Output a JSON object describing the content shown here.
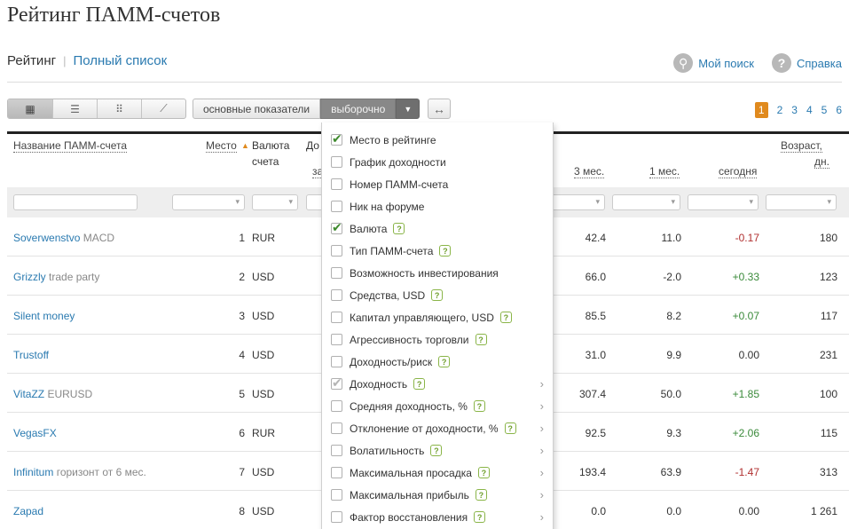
{
  "page": {
    "title": "Рейтинг ПАММ-счетов"
  },
  "tabs": [
    {
      "label": "Рейтинг",
      "active": true
    },
    {
      "label": "Полный список",
      "active": false
    }
  ],
  "top_links": {
    "my_search": "Мой поиск",
    "help": "Справка"
  },
  "view_buttons": [
    {
      "icon": "grid-icon",
      "glyph": "▦"
    },
    {
      "icon": "list-icon",
      "glyph": "☰"
    },
    {
      "icon": "tiles-icon",
      "glyph": "⠿"
    },
    {
      "icon": "chart-icon",
      "glyph": "⟋"
    }
  ],
  "modes": {
    "basic": "основные показатели",
    "custom": "выборочно"
  },
  "pager": {
    "pages": [
      "1",
      "2",
      "3",
      "4",
      "5",
      "6"
    ],
    "current": "1"
  },
  "headers": {
    "name": "Название ПАММ-счета",
    "place": "Место",
    "currency_1": "Валюта",
    "currency_2": "счета",
    "partial_do": "До",
    "partial_za": "за",
    "m3": "3 мес.",
    "m1": "1 мес.",
    "today": "сегодня",
    "age_1": "Возраст,",
    "age_2": "дн."
  },
  "rows": [
    {
      "name": "Soverwenstvo",
      "sub": "MACD",
      "place": "1",
      "currency": "RUR",
      "m3": "42.4",
      "m1": "11.0",
      "today": "-0.17",
      "today_sign": "neg",
      "age": "180"
    },
    {
      "name": "Grizzly",
      "sub": "trade party",
      "place": "2",
      "currency": "USD",
      "m3": "66.0",
      "m1": "-2.0",
      "today": "+0.33",
      "today_sign": "pos",
      "age": "123"
    },
    {
      "name": "Silent money",
      "sub": "",
      "place": "3",
      "currency": "USD",
      "m3": "85.5",
      "m1": "8.2",
      "today": "+0.07",
      "today_sign": "pos",
      "age": "117"
    },
    {
      "name": "Trustoff",
      "sub": "",
      "place": "4",
      "currency": "USD",
      "m3": "31.0",
      "m1": "9.9",
      "today": "0.00",
      "today_sign": "zero",
      "age": "231"
    },
    {
      "name": "VitaZZ",
      "sub": "EURUSD",
      "place": "5",
      "currency": "USD",
      "m3": "307.4",
      "m1": "50.0",
      "today": "+1.85",
      "today_sign": "pos",
      "age": "100"
    },
    {
      "name": "VegasFX",
      "sub": "",
      "place": "6",
      "currency": "RUR",
      "m3": "92.5",
      "m1": "9.3",
      "today": "+2.06",
      "today_sign": "pos",
      "age": "115"
    },
    {
      "name": "Infinitum",
      "sub": "горизонт от 6 мес.",
      "place": "7",
      "currency": "USD",
      "m3": "193.4",
      "m1": "63.9",
      "today": "-1.47",
      "today_sign": "neg",
      "age": "313"
    },
    {
      "name": "Zapad",
      "sub": "",
      "place": "8",
      "currency": "USD",
      "m3": "0.0",
      "m1": "0.0",
      "today": "0.00",
      "today_sign": "zero",
      "age": "1 261"
    }
  ],
  "dropdown": {
    "items": [
      {
        "label": "Место в рейтинге",
        "state": "on",
        "help": false,
        "submenu": false
      },
      {
        "label": "График доходности",
        "state": "off",
        "help": false,
        "submenu": false
      },
      {
        "label": "Номер ПАММ-счета",
        "state": "off",
        "help": false,
        "submenu": false
      },
      {
        "label": "Ник на форуме",
        "state": "off",
        "help": false,
        "submenu": false
      },
      {
        "label": "Валюта",
        "state": "on",
        "help": true,
        "submenu": false
      },
      {
        "label": "Тип ПАММ-счета",
        "state": "off",
        "help": true,
        "submenu": false
      },
      {
        "label": "Возможность инвестирования",
        "state": "off",
        "help": false,
        "submenu": false
      },
      {
        "label": "Средства, USD",
        "state": "off",
        "help": true,
        "submenu": false
      },
      {
        "label": "Капитал управляющего, USD",
        "state": "off",
        "help": true,
        "submenu": false
      },
      {
        "label": "Агрессивность торговли",
        "state": "off",
        "help": true,
        "submenu": false
      },
      {
        "label": "Доходность/риск",
        "state": "off",
        "help": true,
        "submenu": false
      },
      {
        "label": "Доходность",
        "state": "dim",
        "help": true,
        "submenu": true
      },
      {
        "label": "Средняя доходность, %",
        "state": "off",
        "help": true,
        "submenu": true
      },
      {
        "label": "Отклонение от доходности, %",
        "state": "off",
        "help": true,
        "submenu": true
      },
      {
        "label": "Волатильность",
        "state": "off",
        "help": true,
        "submenu": true
      },
      {
        "label": "Максимальная просадка",
        "state": "off",
        "help": true,
        "submenu": true
      },
      {
        "label": "Максимальная прибыль",
        "state": "off",
        "help": true,
        "submenu": true
      },
      {
        "label": "Фактор восстановления",
        "state": "off",
        "help": true,
        "submenu": true
      }
    ]
  }
}
